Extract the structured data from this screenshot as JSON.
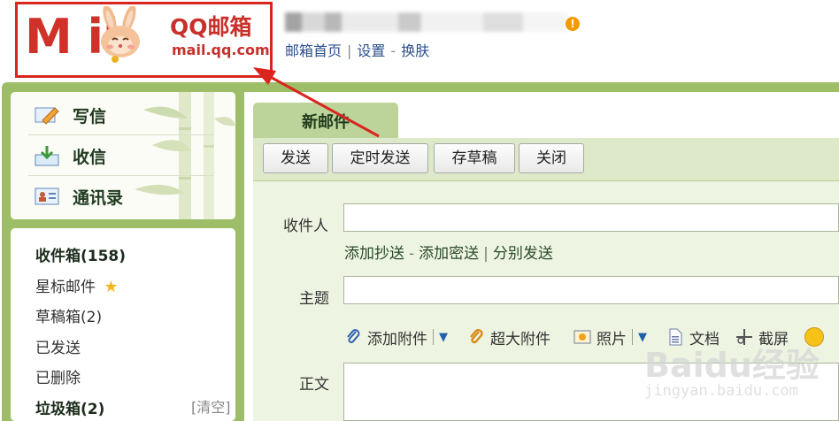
{
  "header": {
    "logo_mail": "M  il",
    "logo_brand": "QQ邮箱",
    "logo_domain": "mail.qq.com",
    "links": [
      "邮箱首页",
      "设置",
      "换肤"
    ],
    "separators": [
      "|",
      "-"
    ]
  },
  "nav": {
    "write": "写信",
    "inbox": "收信",
    "contacts": "通讯录"
  },
  "folders": {
    "inbox": "收件箱(158)",
    "starred": "星标邮件",
    "drafts": "草稿箱(2)",
    "sent": "已发送",
    "deleted": "已删除",
    "spam": "垃圾箱(2)",
    "clear": "[清空]"
  },
  "compose": {
    "tab_title": "新邮件",
    "toolbar": {
      "send": "发送",
      "schedule": "定时发送",
      "save_draft": "存草稿",
      "close": "关闭"
    },
    "to_label": "收件人",
    "to_value": "",
    "cc_links": [
      "添加抄送",
      "添加密送",
      "分别发送"
    ],
    "cc_seps": [
      "-",
      "|"
    ],
    "subject_label": "主题",
    "subject_value": "",
    "attach": {
      "add": "添加附件",
      "large": "超大附件",
      "photo": "照片",
      "doc": "文档",
      "screenshot": "截屏"
    },
    "body_label": "正文"
  },
  "watermark": {
    "line1": "Baidu经验",
    "line2": "jingyan.baidu.com"
  },
  "colors": {
    "brand_red": "#d0322a",
    "frame_green": "#9dbd68",
    "tab_green": "#bcd49a",
    "form_bg": "#eef4e2"
  }
}
